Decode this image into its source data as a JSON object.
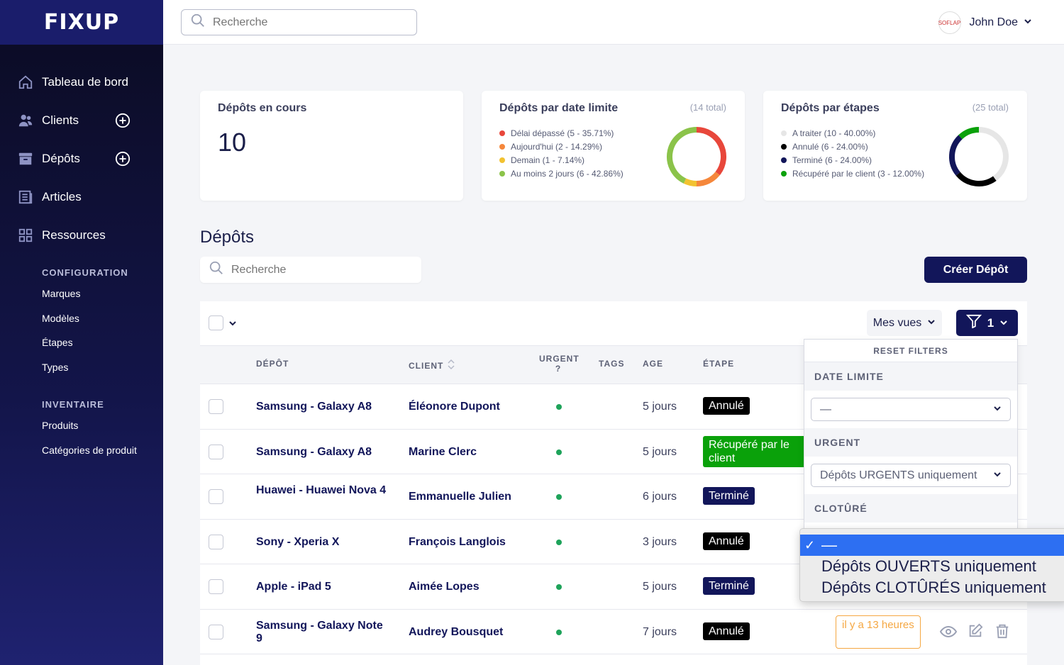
{
  "app": {
    "logo": "FIXUP"
  },
  "sidebar": {
    "items": [
      {
        "label": "Tableau de bord",
        "icon": "home-icon"
      },
      {
        "label": "Clients",
        "icon": "users-icon",
        "add": true
      },
      {
        "label": "Dépôts",
        "icon": "archive-icon",
        "add": true
      },
      {
        "label": "Articles",
        "icon": "list-icon"
      },
      {
        "label": "Ressources",
        "icon": "grid-icon"
      }
    ],
    "configuration": {
      "title": "CONFIGURATION",
      "items": [
        "Marques",
        "Modèles",
        "Étapes",
        "Types"
      ]
    },
    "inventaire": {
      "title": "INVENTAIRE",
      "items": [
        "Produits",
        "Catégories de produit"
      ]
    }
  },
  "topbar": {
    "search_placeholder": "Recherche",
    "user_name": "John Doe",
    "avatar_text": "SOFLAP"
  },
  "cards": {
    "en_cours": {
      "title": "Dépôts en cours",
      "value": "10"
    },
    "date_limite": {
      "title": "Dépôts par date limite",
      "total": "(14 total)",
      "legend": [
        {
          "label": "Délai dépassé (5 - 35.71%)",
          "color": "#e8473b",
          "value": 5
        },
        {
          "label": "Aujourd'hui (2 - 14.29%)",
          "color": "#f5873b",
          "value": 2
        },
        {
          "label": "Demain (1 - 7.14%)",
          "color": "#f2c230",
          "value": 1
        },
        {
          "label": "Au moins 2 jours (6 - 42.86%)",
          "color": "#8bc34a",
          "value": 6
        }
      ]
    },
    "etapes": {
      "title": "Dépôts par étapes",
      "total": "(25 total)",
      "legend": [
        {
          "label": "A traiter (10 - 40.00%)",
          "color": "#e6e6e6",
          "value": 10
        },
        {
          "label": "Annulé (6 - 24.00%)",
          "color": "#000000",
          "value": 6
        },
        {
          "label": "Terminé (6 - 24.00%)",
          "color": "#12165a",
          "value": 6
        },
        {
          "label": "Récupéré par le client (3 - 12.00%)",
          "color": "#0aa10a",
          "value": 3
        }
      ]
    }
  },
  "main": {
    "title": "Dépôts",
    "search_placeholder": "Recherche",
    "create_button": "Créer Dépôt",
    "views_button": "Mes vues",
    "filter_count": "1",
    "columns": {
      "depot": "DÉPÔT",
      "client": "CLIENT",
      "urgent": "URGENT ?",
      "tags": "TAGS",
      "age": "AGE",
      "etape": "ÉTAPE"
    },
    "rows": [
      {
        "device": "Samsung - Galaxy A8",
        "client": "Éléonore Dupont",
        "age": "5 jours",
        "etape": "Annulé",
        "etape_type": "annule"
      },
      {
        "device": "Samsung - Galaxy A8",
        "client": "Marine Clerc",
        "age": "5 jours",
        "etape": "Récupéré par le client",
        "etape_type": "recup"
      },
      {
        "device": "Huawei - Huawei Nova 4",
        "client": "Emmanuelle Julien",
        "age": "6 jours",
        "etape": "Terminé",
        "etape_type": "termine"
      },
      {
        "device": "Sony - Xperia X",
        "client": "François Langlois",
        "age": "3 jours",
        "etape": "Annulé",
        "etape_type": "annule"
      },
      {
        "device": "Apple - iPad 5",
        "client": "Aimée Lopes",
        "age": "5 jours",
        "etape": "Terminé",
        "etape_type": "termine"
      },
      {
        "device": "Samsung - Galaxy Note 9",
        "client": "Audrey Bousquet",
        "age": "7 jours",
        "etape": "Annulé",
        "etape_type": "annule",
        "deadline": "il y a 13 heures"
      }
    ]
  },
  "filters": {
    "reset": "RESET FILTERS",
    "date_limite": {
      "title": "DATE LIMITE",
      "value": "—"
    },
    "urgent": {
      "title": "URGENT",
      "value": "Dépôts URGENTS uniquement"
    },
    "cloture": {
      "title": "CLOTÛRÉ",
      "options": [
        "—",
        "Dépôts OUVERTS uniquement",
        "Dépôts CLOTÛRÉS uniquement"
      ],
      "selected": "—"
    }
  }
}
